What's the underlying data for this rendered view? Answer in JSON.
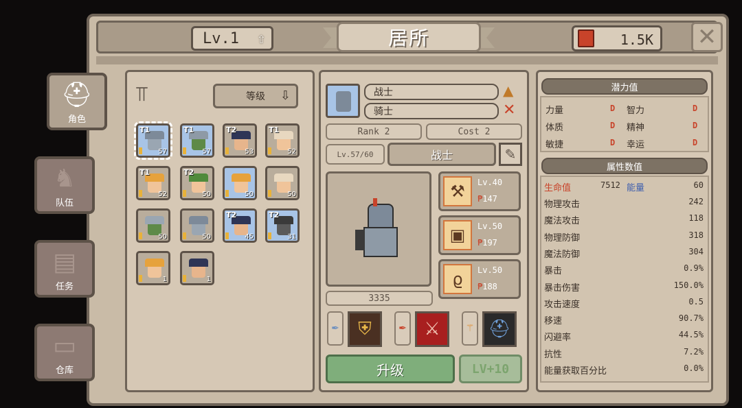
{
  "header": {
    "level": "Lv.1",
    "title": "居所",
    "currency": "1.5K"
  },
  "side_tabs": [
    {
      "label": "角色",
      "icon": "helmet-icon"
    },
    {
      "label": "队伍",
      "icon": "elephant-icon"
    },
    {
      "label": "任务",
      "icon": "map-scroll-icon"
    },
    {
      "label": "仓库",
      "icon": "chest-icon"
    }
  ],
  "roster": {
    "sort_label": "等级",
    "heroes": [
      {
        "tier": "T1",
        "lvl": "57",
        "hat": "#7d8a99",
        "face": "#9aa6b2",
        "bg": "#a8c4e6",
        "selected": true
      },
      {
        "tier": "T1",
        "lvl": "57",
        "hat": "#8e9aa6",
        "face": "#5e8a48",
        "bg": "#a8c4e6"
      },
      {
        "tier": "T2",
        "lvl": "53",
        "hat": "#2e3556",
        "face": "#e7b58c",
        "bg": "#b9ad9c"
      },
      {
        "tier": "T1",
        "lvl": "52",
        "hat": "#e8d8c0",
        "face": "#f0c49a",
        "bg": "#b9ad9c"
      },
      {
        "tier": "T1",
        "lvl": "52",
        "hat": "#e6a23c",
        "face": "#f0c49a",
        "bg": "#b9ad9c"
      },
      {
        "tier": "T2",
        "lvl": "50",
        "hat": "#4f8a3c",
        "face": "#f0c49a",
        "bg": "#b9ad9c"
      },
      {
        "tier": "",
        "lvl": "50",
        "hat": "#e6a23c",
        "face": "#f0c49a",
        "bg": "#a8c4e6"
      },
      {
        "tier": "",
        "lvl": "50",
        "hat": "#e8d8c0",
        "face": "#f0c49a",
        "bg": "#b9ad9c"
      },
      {
        "tier": "",
        "lvl": "50",
        "hat": "#9aa6b2",
        "face": "#5e8a48",
        "bg": "#b9ad9c"
      },
      {
        "tier": "",
        "lvl": "50",
        "hat": "#7d8a99",
        "face": "#9aa6b2",
        "bg": "#b9ad9c"
      },
      {
        "tier": "T2",
        "lvl": "45",
        "hat": "#2e3556",
        "face": "#e7b58c",
        "bg": "#a8c4e6"
      },
      {
        "tier": "T2",
        "lvl": "31",
        "hat": "#3a3a3a",
        "face": "#5a5a5a",
        "bg": "#a8c4e6"
      },
      {
        "tier": "",
        "lvl": "1",
        "hat": "#e6a23c",
        "face": "#f0c49a",
        "bg": "#b9ad9c"
      },
      {
        "tier": "",
        "lvl": "1",
        "hat": "#2e3556",
        "face": "#e7b58c",
        "bg": "#b9ad9c"
      }
    ]
  },
  "hero_detail": {
    "class_name": "战士",
    "sub_name": "骑士",
    "rank": "Rank 2",
    "cost": "Cost 2",
    "exp": "Lv.57/60",
    "role": "战士",
    "power": "3335",
    "equipment": [
      {
        "lv": "Lv.40",
        "power": "147",
        "icon": "axe-icon",
        "glyph": "⚒"
      },
      {
        "lv": "Lv.50",
        "power": "197",
        "icon": "armor-icon",
        "glyph": "▣"
      },
      {
        "lv": "Lv.50",
        "power": "188",
        "icon": "amulet-icon",
        "glyph": "ϱ"
      }
    ],
    "upgrade_label": "升级",
    "lv10_label": "LV+10"
  },
  "potential": {
    "title": "潜力值",
    "items": [
      {
        "label": "力量",
        "grade": "D"
      },
      {
        "label": "智力",
        "grade": "D"
      },
      {
        "label": "体质",
        "grade": "D"
      },
      {
        "label": "精神",
        "grade": "D"
      },
      {
        "label": "敏捷",
        "grade": "D"
      },
      {
        "label": "幸运",
        "grade": "D"
      }
    ]
  },
  "attributes": {
    "title": "属性数值",
    "hp_label": "生命值",
    "hp_value": "7512",
    "energy_label": "能量",
    "energy_value": "60",
    "rows": [
      {
        "label": "物理攻击",
        "value": "242"
      },
      {
        "label": "魔法攻击",
        "value": "118"
      },
      {
        "label": "物理防御",
        "value": "318"
      },
      {
        "label": "魔法防御",
        "value": "304"
      },
      {
        "label": "暴击",
        "value": "0.9%"
      },
      {
        "label": "暴击伤害",
        "value": "150.0%"
      },
      {
        "label": "攻击速度",
        "value": "0.5"
      },
      {
        "label": "移速",
        "value": "90.7%"
      },
      {
        "label": "闪避率",
        "value": "44.5%"
      },
      {
        "label": "抗性",
        "value": "7.2%"
      },
      {
        "label": "能量获取百分比",
        "value": "0.0%"
      }
    ]
  },
  "colors": {
    "hp": "#c8432a",
    "energy": "#3f5fae",
    "upgrade": "#7fae7b"
  }
}
